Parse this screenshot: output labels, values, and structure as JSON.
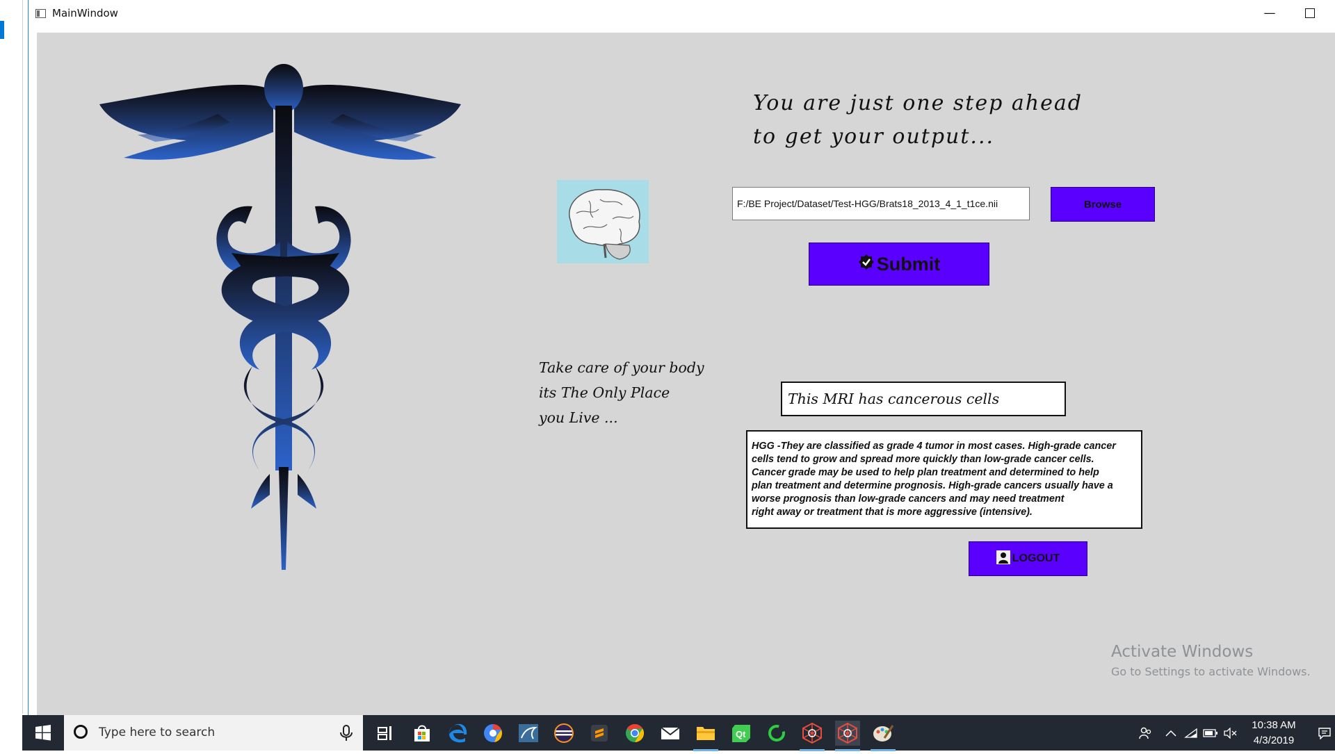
{
  "window": {
    "title": "MainWindow",
    "minimize_glyph": "—",
    "maximize_glyph": ""
  },
  "main": {
    "tagline_line1": "You are just one step ahead",
    "tagline_line2": "to get your output...",
    "path_value": "F:/BE Project/Dataset/Test-HGG/Brats18_2013_4_1_t1ce.nii",
    "browse_label": "Browse",
    "submit_label": "Submit",
    "quote_line1": "Take care of your body",
    "quote_line2": "its The Only Place",
    "quote_line3": "you Live ...",
    "result_text": "This MRI has cancerous cells",
    "description_lines": [
      "HGG -They are classified as grade 4 tumor in most cases. High-grade cancer",
      "cells tend to grow and spread more quickly than low-grade cancer cells.",
      "Cancer grade may be used to help plan treatment and determined to help",
      "plan treatment and determine prognosis. High-grade cancers usually have a",
      "worse prognosis than low-grade cancers and may need treatment",
      "right away or treatment that is more aggressive (intensive)."
    ],
    "logout_label": "LOGOUT"
  },
  "watermark": {
    "line1": "Activate Windows",
    "line2": "Go to Settings to activate Windows."
  },
  "taskbar": {
    "search_placeholder": "Type here to search",
    "clock_time": "10:38 AM",
    "clock_date": "4/3/2019",
    "icons": [
      "task-view-icon",
      "store-icon",
      "edge-icon",
      "chromium-icon",
      "mysql-icon",
      "eclipse-icon",
      "sublime-icon",
      "chrome-icon",
      "mail-icon",
      "file-explorer-icon",
      "qt-icon",
      "refresh-app-icon",
      "spider-app-icon",
      "spider-app-icon-2",
      "paint-app-icon"
    ]
  },
  "colors": {
    "accent_button": "#5a00ff",
    "client_bg": "#d6d6d6",
    "taskbar_bg": "#222933"
  }
}
